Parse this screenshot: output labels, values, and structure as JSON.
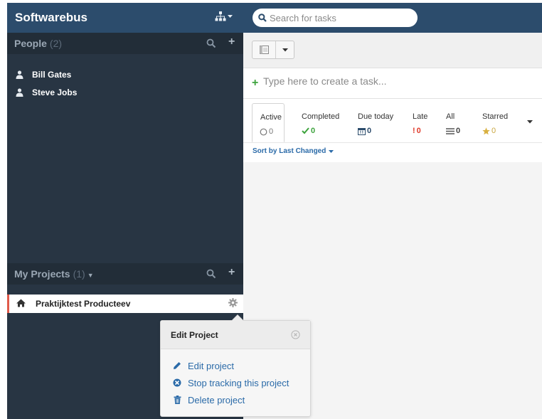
{
  "app": {
    "title": "Softwarebus"
  },
  "search": {
    "placeholder": "Search for tasks"
  },
  "people": {
    "title": "People",
    "count": "(2)",
    "items": [
      {
        "name": "Bill Gates"
      },
      {
        "name": "Steve Jobs"
      }
    ]
  },
  "projects": {
    "title": "My Projects",
    "count": "(1)",
    "items": [
      {
        "name": "Praktijktest Producteev"
      }
    ]
  },
  "popover": {
    "title": "Edit Project",
    "items": [
      {
        "label": "Edit project",
        "icon": "pencil-icon"
      },
      {
        "label": "Stop tracking this project",
        "icon": "ban-icon"
      },
      {
        "label": "Delete project",
        "icon": "trash-icon"
      }
    ]
  },
  "create_task": {
    "placeholder": "Type here to create a task..."
  },
  "filters": [
    {
      "label": "Active",
      "count": "0",
      "icon": "circle-outline-icon",
      "color": "#777777"
    },
    {
      "label": "Completed",
      "count": "0",
      "icon": "check-icon",
      "color": "#3da33d"
    },
    {
      "label": "Due today",
      "count": "0",
      "icon": "calendar-icon",
      "color": "#2c4c6c"
    },
    {
      "label": "Late",
      "count": "0",
      "icon": "exclamation-icon",
      "color": "#e03a2a"
    },
    {
      "label": "All",
      "count": "0",
      "icon": "list-icon",
      "color": "#555555"
    },
    {
      "label": "Starred",
      "count": "0",
      "icon": "star-icon",
      "color": "#d8b040"
    }
  ],
  "sort": {
    "label": "Sort by Last Changed"
  },
  "colors": {
    "header_blue": "#2c4c6c",
    "sidebar": "#283543",
    "link_blue": "#2a6aa8",
    "project_accent": "#e05a4a"
  }
}
